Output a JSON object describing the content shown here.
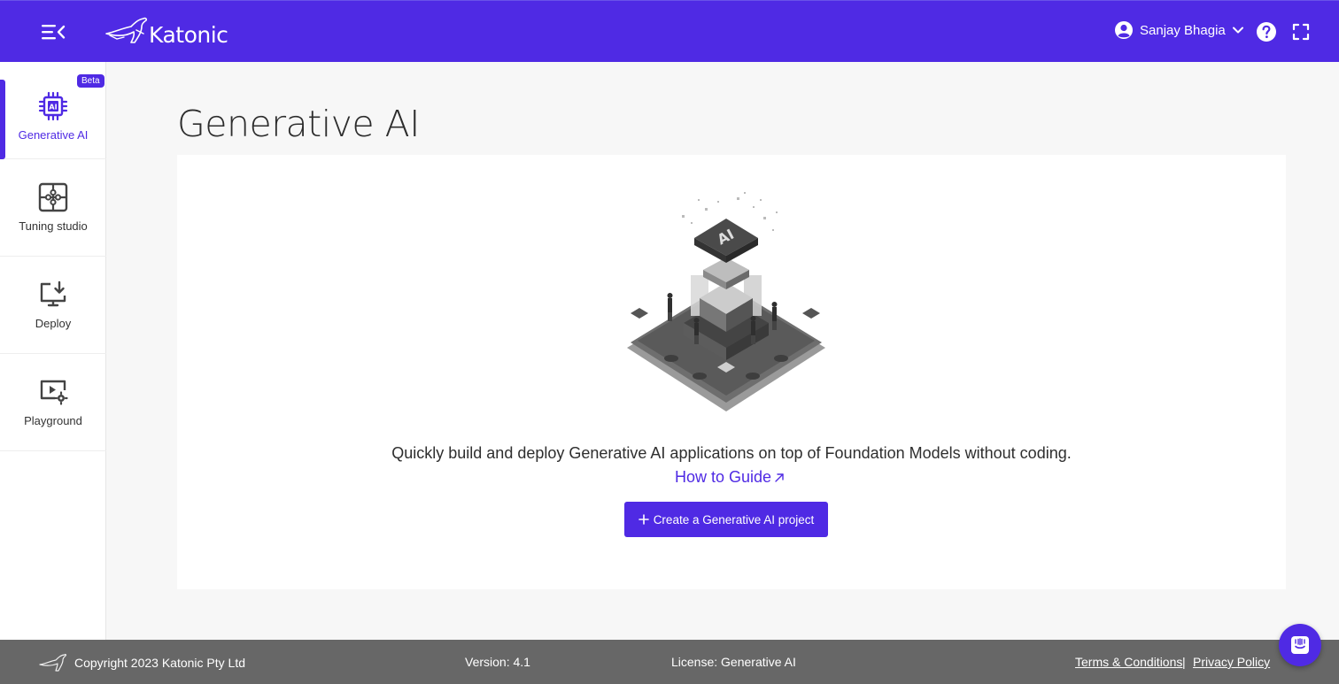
{
  "header": {
    "brand": "Katonic",
    "user_name": "Sanjay Bhagia",
    "icons": {
      "menu": "menu-collapse-icon",
      "user": "user-circle-icon",
      "help": "help-circle-icon",
      "fullscreen": "fullscreen-icon"
    }
  },
  "sidebar": {
    "items": [
      {
        "label": "Generative AI",
        "icon": "ai-chip-icon",
        "badge": "Beta",
        "active": true
      },
      {
        "label": "Tuning studio",
        "icon": "puzzle-icon",
        "active": false
      },
      {
        "label": "Deploy",
        "icon": "monitor-download-icon",
        "active": false
      },
      {
        "label": "Playground",
        "icon": "video-settings-icon",
        "active": false
      }
    ]
  },
  "main": {
    "title": "Generative AI",
    "illustration_label": "AI",
    "description": "Quickly build and deploy Generative AI applications on top of Foundation Models without coding.",
    "guide_link": "How to Guide",
    "create_button": "Create a Generative AI project"
  },
  "footer": {
    "copyright": "Copyright 2023 Katonic Pty Ltd",
    "version": "Version: 4.1",
    "license": "License: Generative AI",
    "terms": "Terms & Conditions",
    "separator": "|",
    "privacy": "Privacy Policy"
  },
  "colors": {
    "brand": "#4f2ae4",
    "footer": "#676767",
    "background": "#f7f7f7"
  }
}
